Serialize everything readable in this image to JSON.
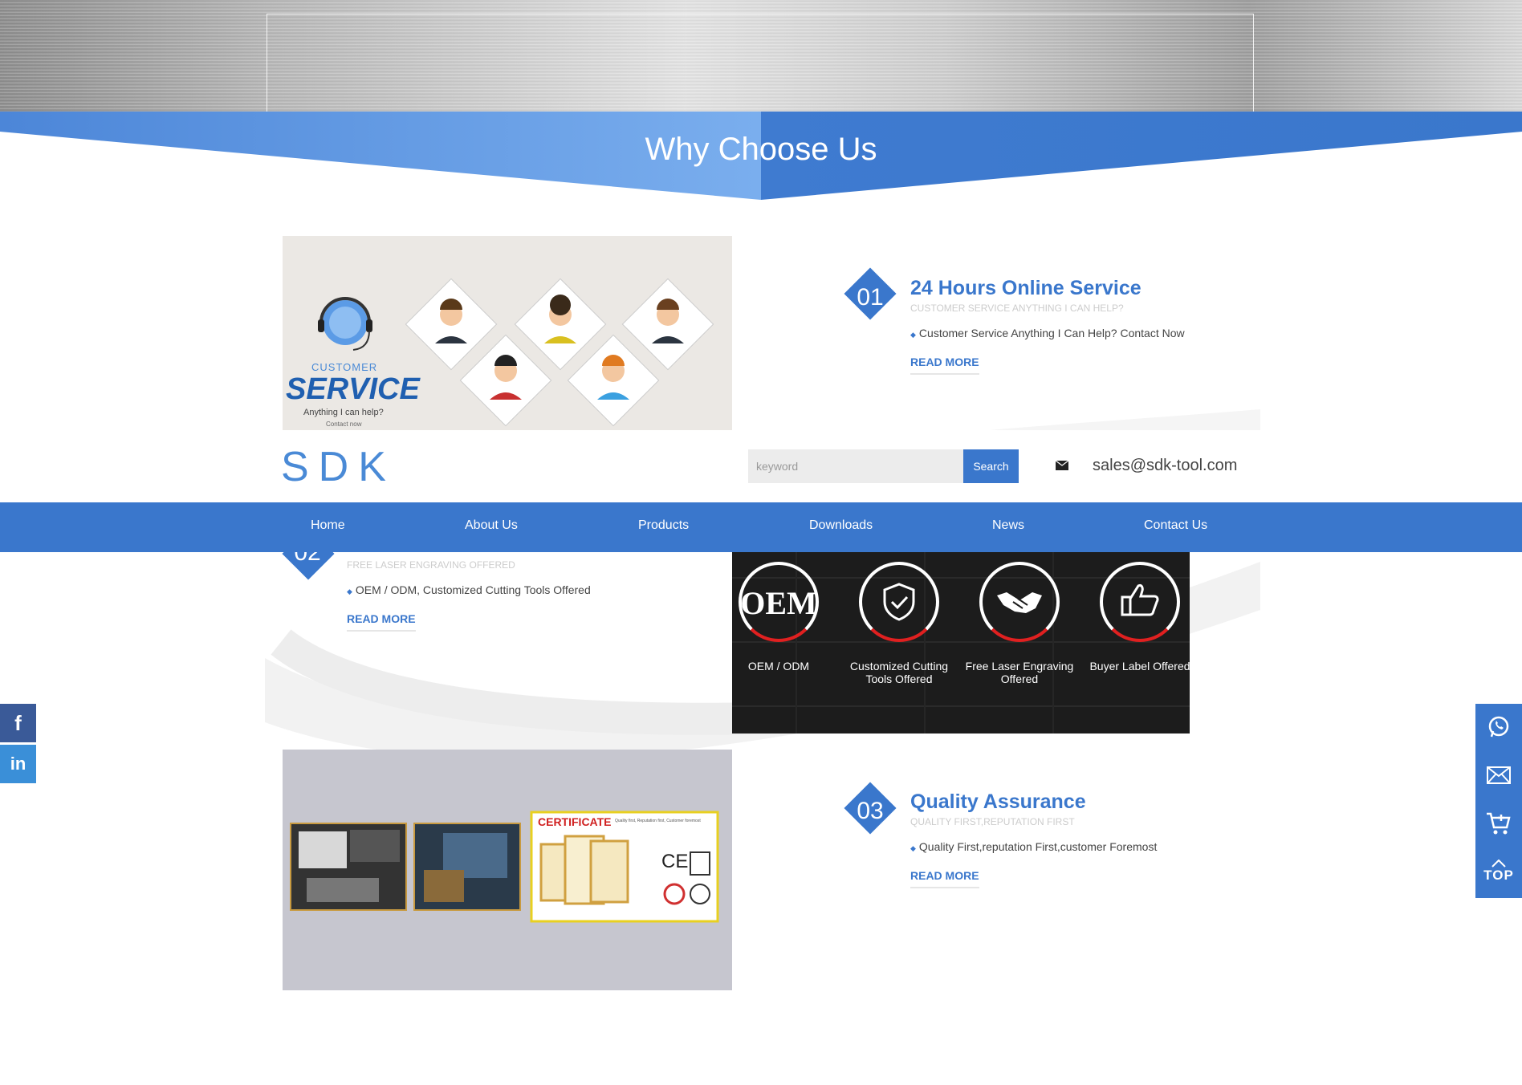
{
  "section": {
    "title": "Why Choose Us"
  },
  "features": [
    {
      "number": "01",
      "title": "24 Hours Online Service",
      "subtitle": "CUSTOMER SERVICE ANYTHING I CAN HELP?",
      "description": "Customer Service Anything I Can Help? Contact Now",
      "read_more": "READ MORE"
    },
    {
      "number": "02",
      "title": "",
      "subtitle": "FREE LASER ENGRAVING OFFERED",
      "description": "OEM / ODM, Customized Cutting Tools Offered",
      "read_more": "READ MORE"
    },
    {
      "number": "03",
      "title": "Quality Assurance",
      "subtitle": "QUALITY FIRST,REPUTATION FIRST",
      "description": "Quality First,reputation First,customer Foremost",
      "read_more": "READ MORE"
    }
  ],
  "service_image": {
    "customer": "CUSTOMER",
    "service": "SERVICE",
    "help": "Anything I can help?",
    "contact": "Contact now"
  },
  "oem_panel": {
    "items": [
      {
        "badge": "OEM",
        "label": "OEM / ODM",
        "icon": "oem-text-icon"
      },
      {
        "badge": "",
        "label": "Customized Cutting Tools Offered",
        "icon": "shield-check-icon"
      },
      {
        "badge": "",
        "label": "Free Laser Engraving Offered",
        "icon": "handshake-icon"
      },
      {
        "badge": "",
        "label": "Buyer Label Offered",
        "icon": "thumbs-up-icon"
      }
    ]
  },
  "quality_image": {
    "certificate_title": "CERTIFICATE",
    "certificate_tagline": "Quality first, Reputation first, Customer foremost",
    "ce_mark": "CE"
  },
  "header": {
    "logo": "SDK",
    "search_placeholder": "keyword",
    "search_button": "Search",
    "email": "sales@sdk-tool.com",
    "email_icon": "envelope-icon"
  },
  "nav": {
    "items": [
      "Home",
      "About Us",
      "Products",
      "Downloads",
      "News",
      "Contact Us"
    ]
  },
  "social": {
    "facebook": "f",
    "linkedin": "in"
  },
  "float_bar": {
    "top_label": "TOP",
    "icons": [
      "whatsapp-icon",
      "email-icon",
      "cart-icon",
      "top-icon"
    ]
  },
  "colors": {
    "accent": "#3a77cc",
    "accent_light": "#6fa8ea",
    "dark_panel": "#1e1e1e",
    "oem_red": "#e02020"
  }
}
